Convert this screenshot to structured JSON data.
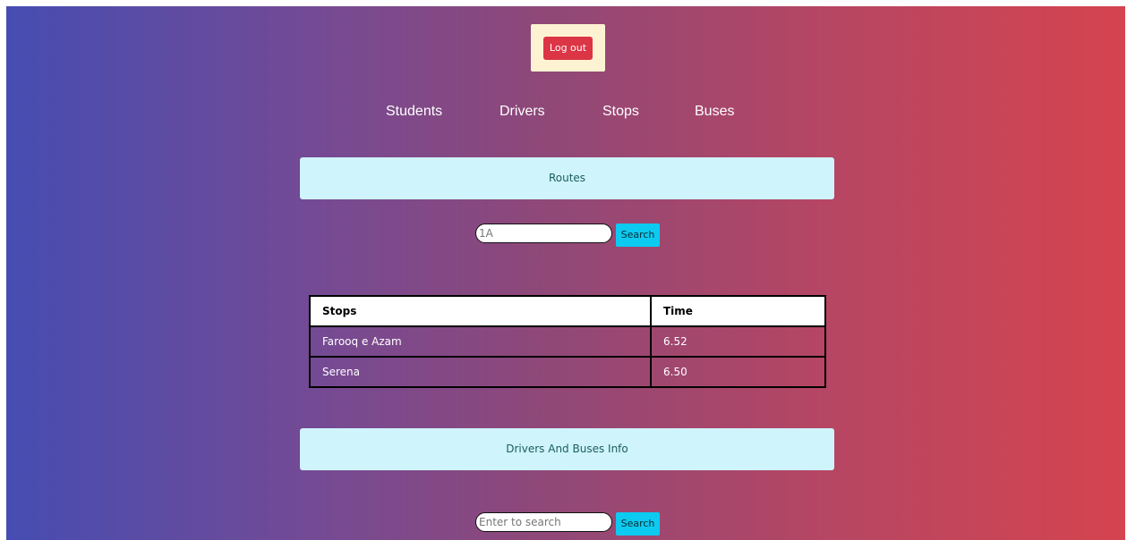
{
  "header": {
    "logout_label": "Log out"
  },
  "nav": {
    "items": [
      {
        "label": "Students"
      },
      {
        "label": "Drivers"
      },
      {
        "label": "Stops"
      },
      {
        "label": "Buses"
      }
    ]
  },
  "routes_section": {
    "title": "Routes",
    "search": {
      "value": "",
      "placeholder": "1A",
      "button_label": "Search"
    },
    "table": {
      "headers": [
        "Stops",
        "Time"
      ],
      "rows": [
        [
          "Farooq e Azam",
          "6.52"
        ],
        [
          "Serena",
          "6.50"
        ]
      ]
    }
  },
  "drivers_section": {
    "title": "Drivers And Buses Info",
    "search": {
      "value": "",
      "placeholder": "Enter to search",
      "button_label": "Search"
    }
  },
  "colors": {
    "gradient_start": "#464db2",
    "gradient_end": "#d5444f",
    "logout_button": "#dc3545",
    "logout_card": "#fdf3d2",
    "banner": "#cff4fc",
    "banner_text": "#1b5f5b",
    "search_button": "#0dcaf0"
  }
}
